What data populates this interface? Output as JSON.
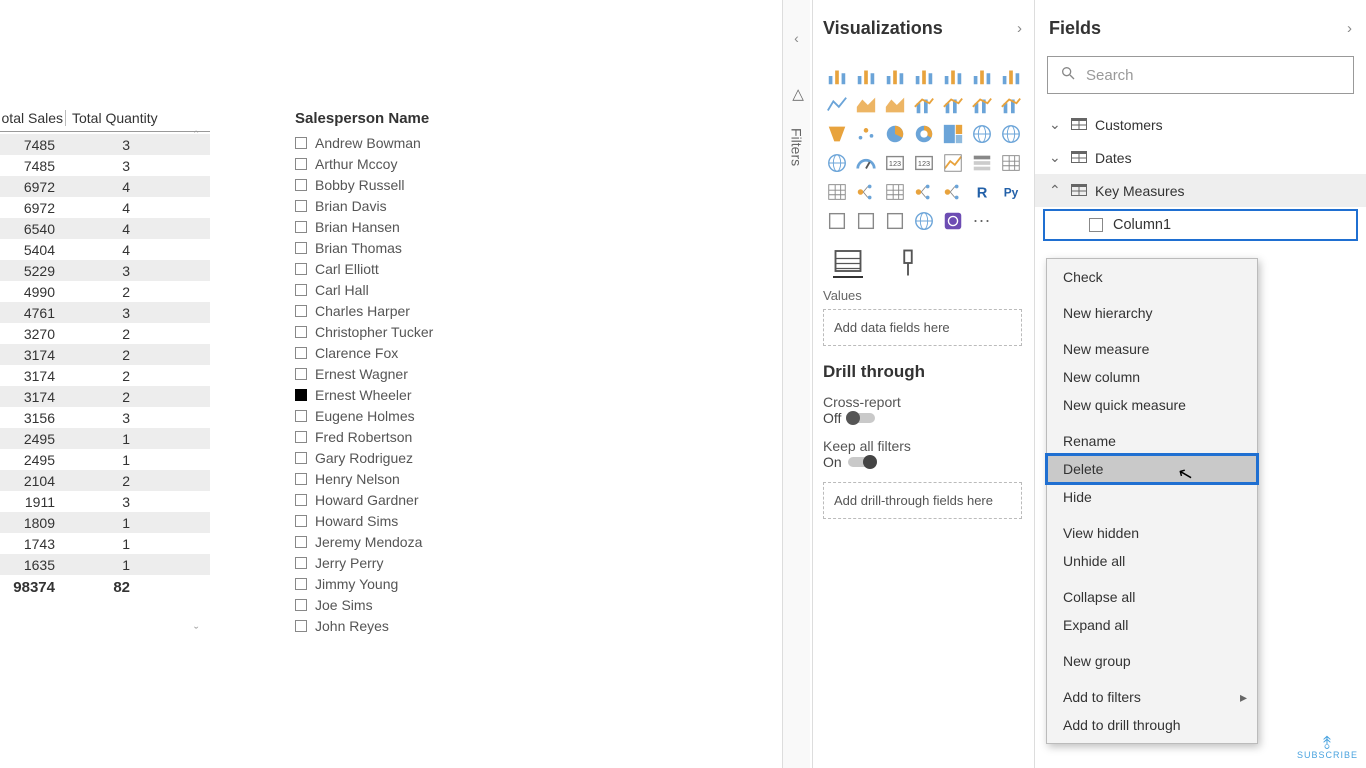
{
  "sales_table": {
    "columns": [
      "otal Sales",
      "Total Quantity"
    ],
    "rows": [
      [
        7485,
        3
      ],
      [
        7485,
        3
      ],
      [
        6972,
        4
      ],
      [
        6972,
        4
      ],
      [
        6540,
        4
      ],
      [
        5404,
        4
      ],
      [
        5229,
        3
      ],
      [
        4990,
        2
      ],
      [
        4761,
        3
      ],
      [
        3270,
        2
      ],
      [
        3174,
        2
      ],
      [
        3174,
        2
      ],
      [
        3174,
        2
      ],
      [
        3156,
        3
      ],
      [
        2495,
        1
      ],
      [
        2495,
        1
      ],
      [
        2104,
        2
      ],
      [
        1911,
        3
      ],
      [
        1809,
        1
      ],
      [
        1743,
        1
      ],
      [
        1635,
        1
      ]
    ],
    "footer": [
      98374,
      82
    ],
    "scroll_up": "ˆ",
    "scroll_down": "ˇ"
  },
  "slicer": {
    "title": "Salesperson Name",
    "items": [
      {
        "name": "Andrew Bowman",
        "checked": false
      },
      {
        "name": "Arthur Mccoy",
        "checked": false
      },
      {
        "name": "Bobby Russell",
        "checked": false
      },
      {
        "name": "Brian Davis",
        "checked": false
      },
      {
        "name": "Brian Hansen",
        "checked": false
      },
      {
        "name": "Brian Thomas",
        "checked": false
      },
      {
        "name": "Carl Elliott",
        "checked": false
      },
      {
        "name": "Carl Hall",
        "checked": false
      },
      {
        "name": "Charles Harper",
        "checked": false
      },
      {
        "name": "Christopher Tucker",
        "checked": false
      },
      {
        "name": "Clarence Fox",
        "checked": false
      },
      {
        "name": "Ernest Wagner",
        "checked": false
      },
      {
        "name": "Ernest Wheeler",
        "checked": true
      },
      {
        "name": "Eugene Holmes",
        "checked": false
      },
      {
        "name": "Fred Robertson",
        "checked": false
      },
      {
        "name": "Gary Rodriguez",
        "checked": false
      },
      {
        "name": "Henry Nelson",
        "checked": false
      },
      {
        "name": "Howard Gardner",
        "checked": false
      },
      {
        "name": "Howard Sims",
        "checked": false
      },
      {
        "name": "Jeremy Mendoza",
        "checked": false
      },
      {
        "name": "Jerry Perry",
        "checked": false
      },
      {
        "name": "Jimmy Young",
        "checked": false
      },
      {
        "name": "Joe Sims",
        "checked": false
      },
      {
        "name": "John Reyes",
        "checked": false
      }
    ]
  },
  "filters_tab": {
    "label": "Filters"
  },
  "viz_pane": {
    "title": "Visualizations",
    "more": "···",
    "tab_labels": {
      "values": "Values",
      "drill": "Drill through"
    },
    "well_values": "Add data fields here",
    "well_drill": "Add drill-through fields here",
    "cross_report": {
      "label": "Cross-report",
      "state": "Off"
    },
    "keep_filters": {
      "label": "Keep all filters",
      "state": "On"
    }
  },
  "fields_pane": {
    "title": "Fields",
    "search_placeholder": "Search",
    "tables": [
      {
        "name": "Customers",
        "expanded": false
      },
      {
        "name": "Dates",
        "expanded": false
      },
      {
        "name": "Key Measures",
        "expanded": true,
        "selected": true,
        "fields": [
          {
            "name": "Column1",
            "highlighted": true
          }
        ]
      }
    ]
  },
  "context_menu": {
    "items": [
      {
        "label": "Check"
      },
      {
        "sep": true
      },
      {
        "label": "New hierarchy"
      },
      {
        "sep": true
      },
      {
        "label": "New measure"
      },
      {
        "label": "New column"
      },
      {
        "label": "New quick measure"
      },
      {
        "sep": true
      },
      {
        "label": "Rename"
      },
      {
        "label": "Delete",
        "hover": true
      },
      {
        "label": "Hide"
      },
      {
        "sep": true
      },
      {
        "label": "View hidden"
      },
      {
        "label": "Unhide all"
      },
      {
        "sep": true
      },
      {
        "label": "Collapse all"
      },
      {
        "label": "Expand all"
      },
      {
        "sep": true
      },
      {
        "label": "New group"
      },
      {
        "sep": true
      },
      {
        "label": "Add to filters",
        "submenu": true
      },
      {
        "label": "Add to drill through"
      }
    ]
  },
  "subscribe": "SUBSCRIBE"
}
